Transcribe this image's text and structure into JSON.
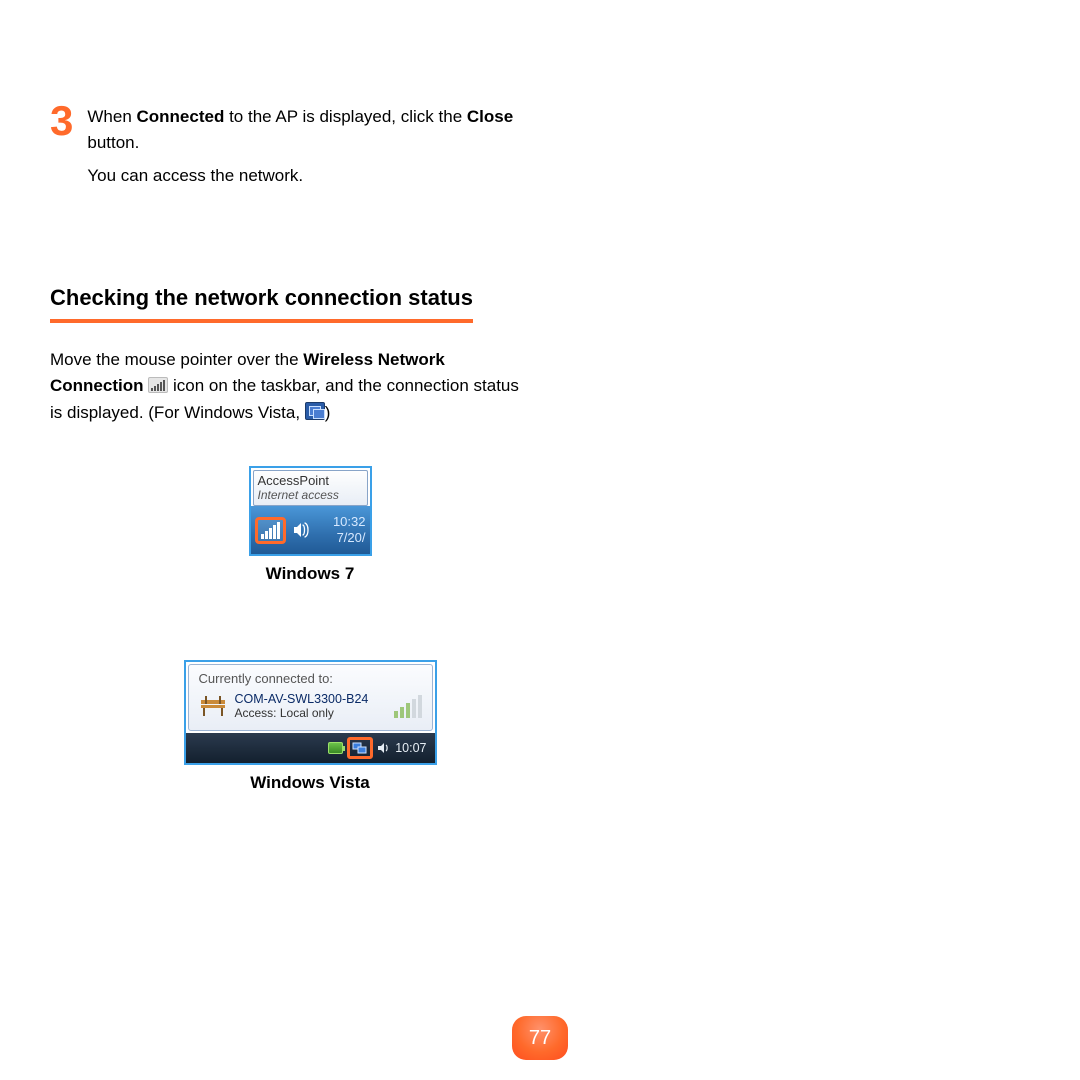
{
  "step": {
    "number": "3",
    "line1_pre": "When ",
    "line1_bold1": "Connected",
    "line1_mid": " to the AP is displayed, click the ",
    "line1_bold2": "Close",
    "line1_post": " button.",
    "line2": "You can access the network."
  },
  "section": {
    "title": "Checking the network connection status",
    "p1_pre": "Move the mouse pointer over the ",
    "p1_bold": "Wireless Network Connection",
    "p1_mid": " icon on the taskbar, and the connection status is displayed. (For Windows Vista, ",
    "p1_post": ")"
  },
  "win7": {
    "tooltip_name": "AccessPoint",
    "tooltip_status": "Internet access",
    "clock_time": "10:32",
    "clock_date": "7/20/",
    "caption": "Windows 7"
  },
  "vista": {
    "popup_header": "Currently connected to:",
    "network_name": "COM-AV-SWL3300-B24",
    "access_label": "Access:  Local only",
    "clock": "10:07",
    "caption": "Windows Vista"
  },
  "page_number": "77"
}
